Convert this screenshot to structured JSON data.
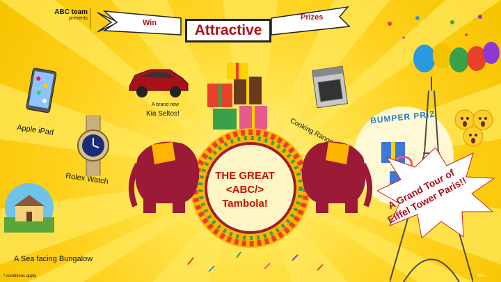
{
  "brand": {
    "team": "ABC team",
    "presents": "presents"
  },
  "banner": {
    "left": "Win",
    "center": "Attractive",
    "right": "Prizes"
  },
  "prizes": {
    "ipad": "Apple iPad",
    "rolex": "Rolex Watch",
    "bungalow": "A Sea facing Bungalow",
    "kia_line1": "A brand new",
    "kia_line2": "Kia Seltos!",
    "range": "Cooking Range",
    "bumper": "BUMPER PRIZ"
  },
  "center": {
    "line1": "THE GREAT",
    "line2": "<ABC/>",
    "line3": "Tambola!"
  },
  "grand_prize": {
    "line1": "A Grand Tour of",
    "line2": "Eiffel Tower Paris!!"
  },
  "footer": {
    "conditions": "* conditions apply",
    "credit": "AvG"
  },
  "colors": {
    "background": "#ffd21f",
    "accent_red": "#b0101a",
    "banner_white": "#ffffff"
  }
}
